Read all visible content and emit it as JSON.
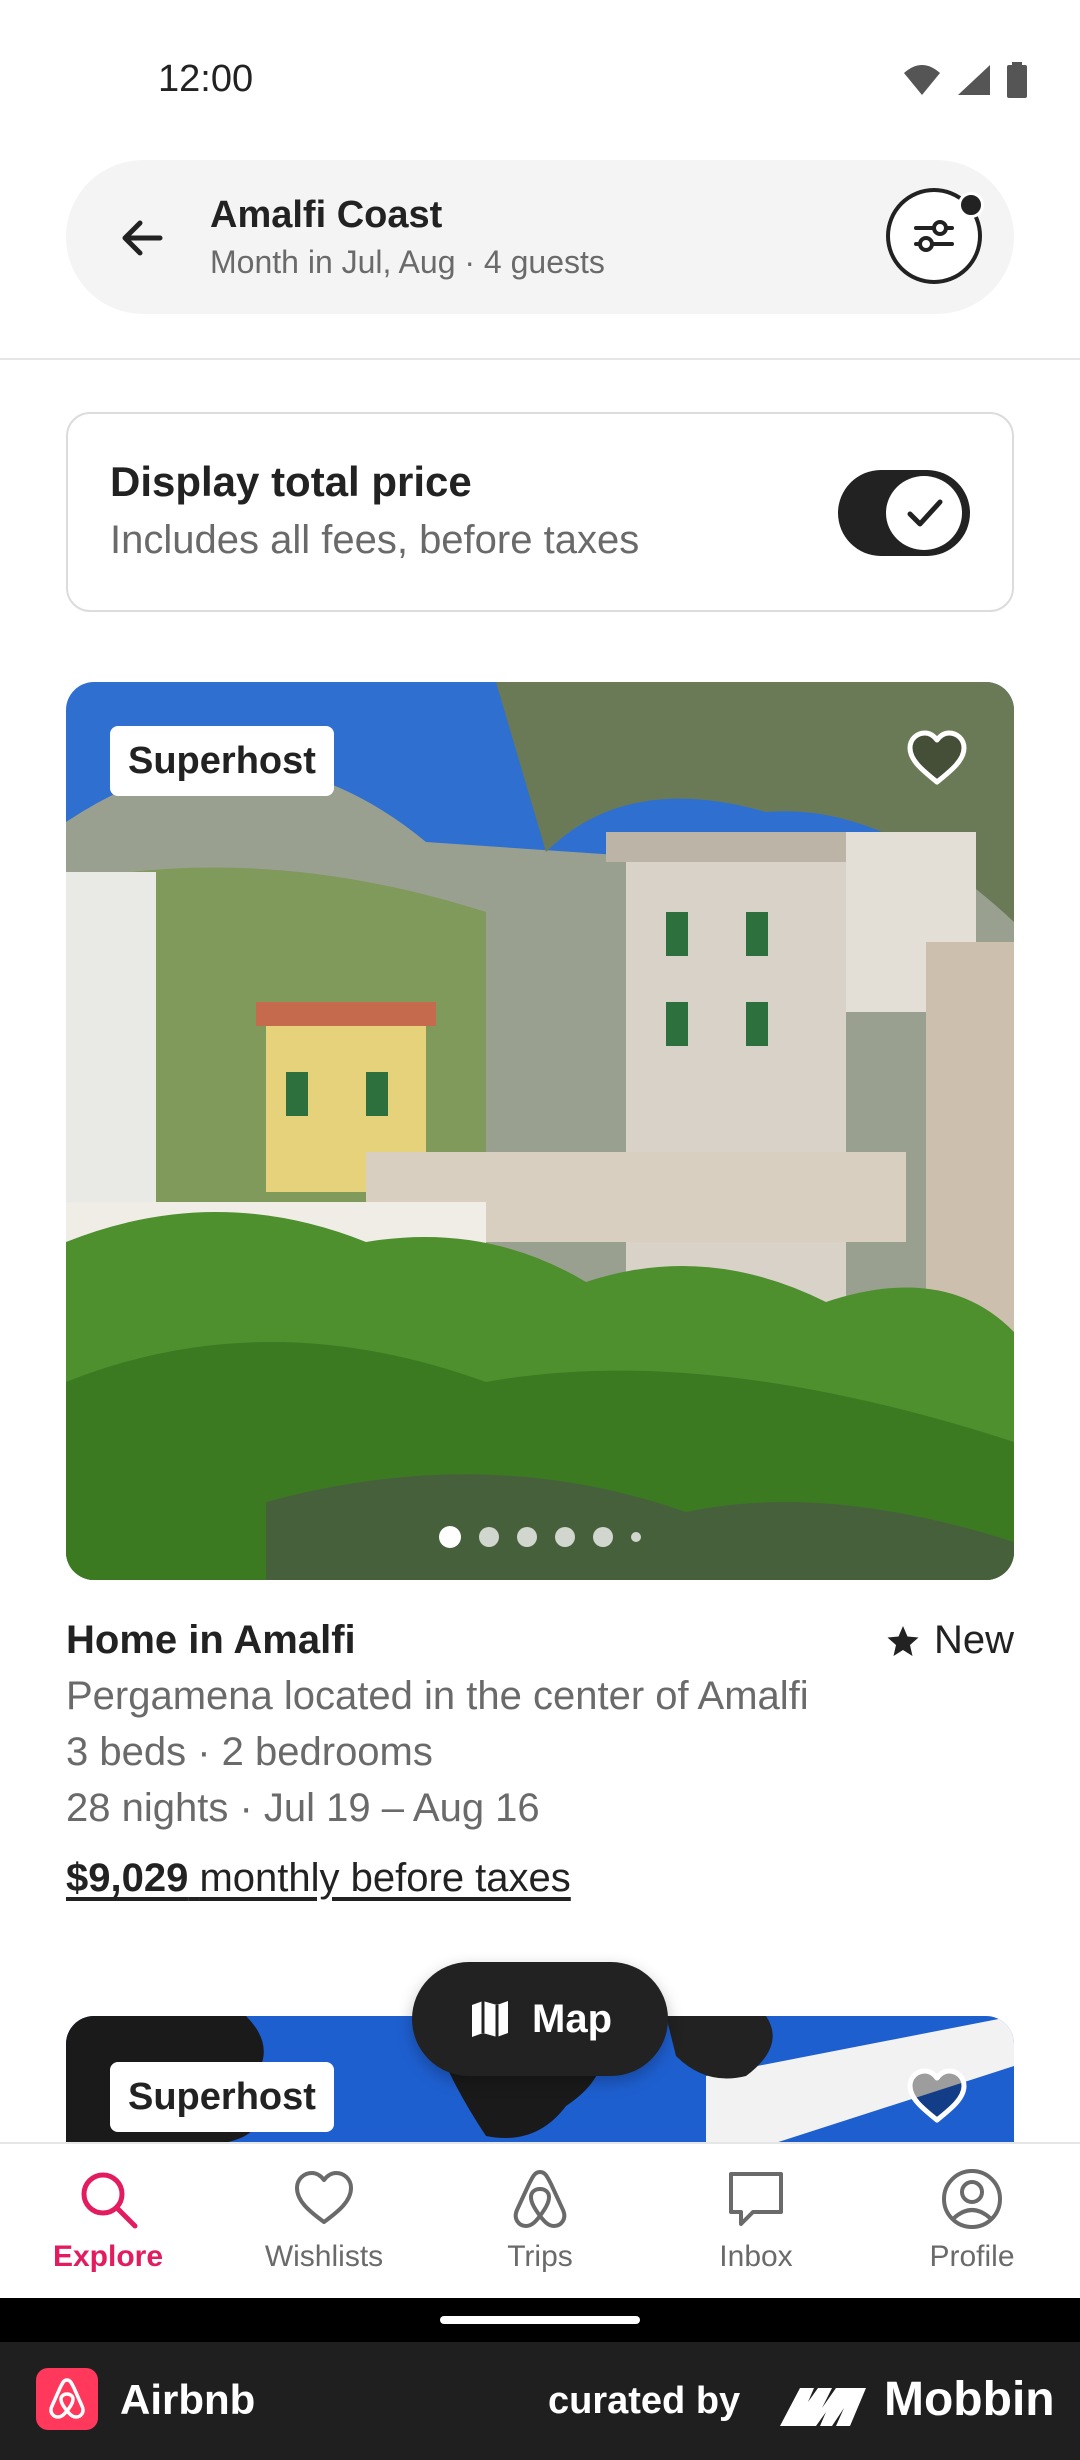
{
  "status_bar": {
    "time": "12:00"
  },
  "search": {
    "location": "Amalfi Coast",
    "details": "Month in Jul, Aug · 4 guests"
  },
  "price_toggle": {
    "title": "Display total price",
    "subtitle": "Includes all fees, before taxes",
    "enabled": true
  },
  "listings": [
    {
      "badge": "Superhost",
      "title": "Home in Amalfi",
      "rating_label": "New",
      "description": "Pergamena located in the center of Amalfi",
      "rooms": "3 beds · 2 bedrooms",
      "dates": "28 nights · Jul 19 – Aug 16",
      "price": "$9,029",
      "price_suffix": "monthly before taxes",
      "photo_count": 6,
      "active_photo": 0
    },
    {
      "badge": "Superhost"
    }
  ],
  "map_button": {
    "label": "Map"
  },
  "bottom_nav": [
    {
      "label": "Explore",
      "icon": "search-icon",
      "active": true
    },
    {
      "label": "Wishlists",
      "icon": "heart-icon",
      "active": false
    },
    {
      "label": "Trips",
      "icon": "airbnb-icon",
      "active": false
    },
    {
      "label": "Inbox",
      "icon": "message-icon",
      "active": false
    },
    {
      "label": "Profile",
      "icon": "profile-icon",
      "active": false
    }
  ],
  "footer": {
    "app_name": "Airbnb",
    "curated_by": "curated by",
    "brand": "Mobbin"
  },
  "colors": {
    "accent": "#e31c5f",
    "text": "#222222",
    "muted": "#6a6a6a"
  }
}
